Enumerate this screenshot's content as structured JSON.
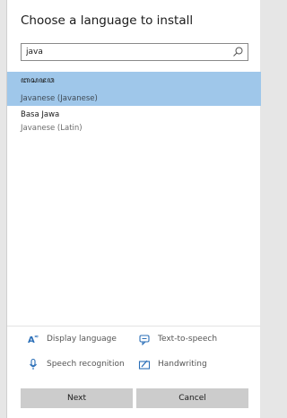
{
  "dialog": {
    "title": "Choose a language to install"
  },
  "search": {
    "value": "java"
  },
  "languages": [
    {
      "native_name": "ꦧꦱꦗꦮ",
      "name": "Javanese (Javanese)",
      "selected": true
    },
    {
      "native_name": "Basa Jawa",
      "name": "Javanese (Latin)",
      "selected": false
    }
  ],
  "features": {
    "display_language": "Display language",
    "text_to_speech": "Text-to-speech",
    "speech_recognition": "Speech recognition",
    "handwriting": "Handwriting"
  },
  "buttons": {
    "next": "Next",
    "cancel": "Cancel"
  },
  "colors": {
    "selected_row": "#9fc7ea",
    "feature_icon": "#2b6fb8",
    "button": "#cccccc"
  }
}
